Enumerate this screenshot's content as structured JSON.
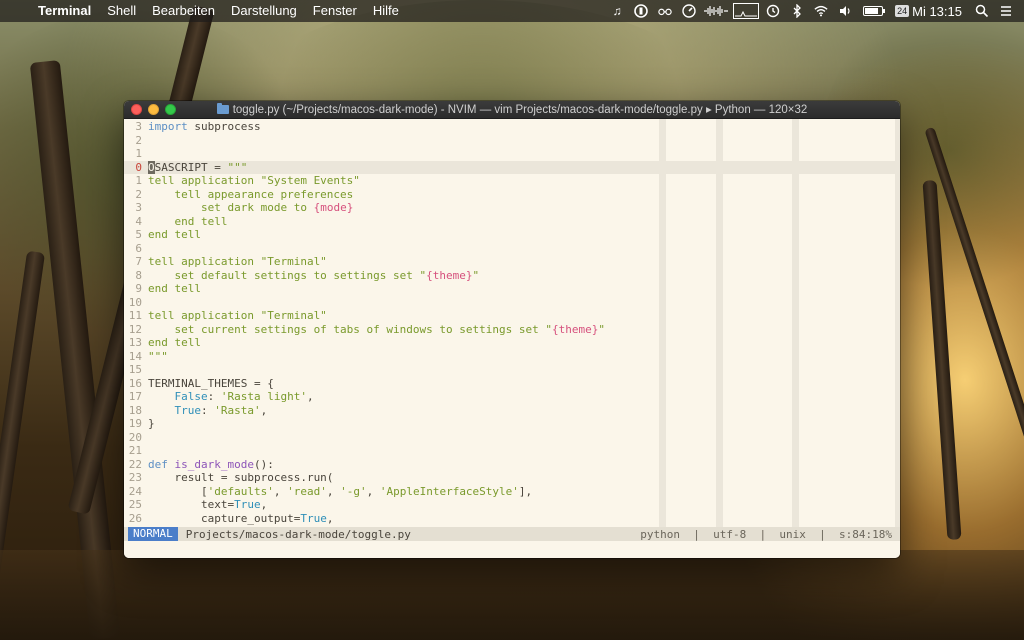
{
  "menubar": {
    "app": "Terminal",
    "items": [
      "Shell",
      "Bearbeiten",
      "Darstellung",
      "Fenster",
      "Hilfe"
    ],
    "calendar_day": "24",
    "clock": "Mi 13:15",
    "battery_level": 0.7
  },
  "window": {
    "title": "toggle.py (~/Projects/macos-dark-mode) - NVIM — vim Projects/macos-dark-mode/toggle.py ▸ Python — 120×32"
  },
  "editor": {
    "lines": [
      {
        "n": "3",
        "html": "<span class=\"kw\">import</span> subprocess"
      },
      {
        "n": "2",
        "html": ""
      },
      {
        "n": "1",
        "html": ""
      },
      {
        "n": "0",
        "html": "<span class=\"cursor\">O</span>SASCRIPT = <span class=\"str\">\"\"\"</span>",
        "current": true
      },
      {
        "n": "1",
        "html": "<span class=\"str\">tell application \"System Events\"</span>"
      },
      {
        "n": "2",
        "html": "<span class=\"str\">    tell appearance preferences</span>"
      },
      {
        "n": "3",
        "html": "<span class=\"str\">        set dark mode to </span><span class=\"interp\">{mode}</span>"
      },
      {
        "n": "4",
        "html": "<span class=\"str\">    end tell</span>"
      },
      {
        "n": "5",
        "html": "<span class=\"str\">end tell</span>"
      },
      {
        "n": "6",
        "html": ""
      },
      {
        "n": "7",
        "html": "<span class=\"str\">tell application \"Terminal\"</span>"
      },
      {
        "n": "8",
        "html": "<span class=\"str\">    set default settings to settings set \"</span><span class=\"interp\">{theme}</span><span class=\"str\">\"</span>"
      },
      {
        "n": "9",
        "html": "<span class=\"str\">end tell</span>"
      },
      {
        "n": "10",
        "html": ""
      },
      {
        "n": "11",
        "html": "<span class=\"str\">tell application \"Terminal\"</span>"
      },
      {
        "n": "12",
        "html": "<span class=\"str\">    set current settings of tabs of windows to settings set \"</span><span class=\"interp\">{theme}</span><span class=\"str\">\"</span>"
      },
      {
        "n": "13",
        "html": "<span class=\"str\">end tell</span>"
      },
      {
        "n": "14",
        "html": "<span class=\"str\">\"\"\"</span>"
      },
      {
        "n": "15",
        "html": ""
      },
      {
        "n": "16",
        "html": "TERMINAL_THEMES = {"
      },
      {
        "n": "17",
        "html": "    <span class=\"bool\">False</span>: <span class=\"str\">'Rasta light'</span>,"
      },
      {
        "n": "18",
        "html": "    <span class=\"bool\">True</span>: <span class=\"str\">'Rasta'</span>,"
      },
      {
        "n": "19",
        "html": "}"
      },
      {
        "n": "20",
        "html": ""
      },
      {
        "n": "21",
        "html": ""
      },
      {
        "n": "22",
        "html": "<span class=\"kw\">def</span> <span class=\"fn\">is_dark_mode</span>():"
      },
      {
        "n": "23",
        "html": "    result = subprocess.run("
      },
      {
        "n": "24",
        "html": "        [<span class=\"str\">'defaults'</span>, <span class=\"str\">'read'</span>, <span class=\"str\">'-g'</span>, <span class=\"str\">'AppleInterfaceStyle'</span>],"
      },
      {
        "n": "25",
        "html": "        text=<span class=\"bool\">True</span>,"
      },
      {
        "n": "26",
        "html": "        capture_output=<span class=\"bool\">True</span>,"
      }
    ]
  },
  "statusline": {
    "mode": "NORMAL",
    "path": "Projects/macos-dark-mode/toggle.py",
    "filetype": "python",
    "encoding": "utf-8",
    "format": "unix",
    "spaces": "s:8",
    "position": "4:1",
    "percent": "8%"
  }
}
